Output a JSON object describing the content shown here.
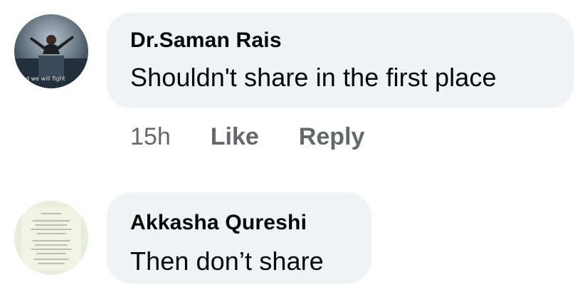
{
  "comments": [
    {
      "author": "Dr.Saman Rais",
      "text": "Shouldn't share in the first place",
      "avatar_caption": "and we will fight",
      "time": "15h",
      "like_label": "Like",
      "reply_label": "Reply"
    },
    {
      "author": "Akkasha Qureshi",
      "text": "Then don’t share"
    }
  ],
  "colors": {
    "bubble": "#f0f2f5",
    "meta_text": "#65676b",
    "primary_text": "#050505"
  }
}
